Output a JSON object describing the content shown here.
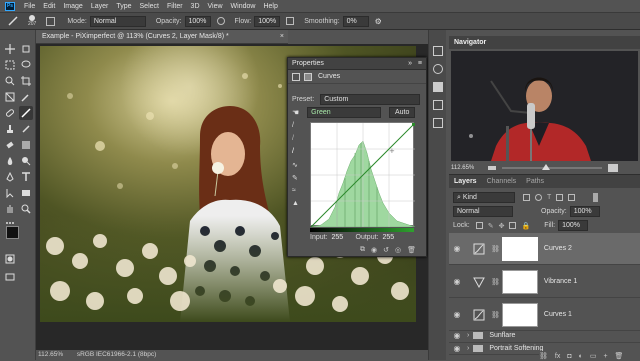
{
  "app": {
    "logo": "Ps"
  },
  "menu": [
    "File",
    "Edit",
    "Image",
    "Layer",
    "Type",
    "Select",
    "Filter",
    "3D",
    "View",
    "Window",
    "Help"
  ],
  "options": {
    "brush_size": "207",
    "mode_label": "Mode:",
    "mode_value": "Normal",
    "opacity_label": "Opacity:",
    "opacity_value": "100%",
    "flow_label": "Flow:",
    "flow_value": "100%",
    "smoothing_label": "Smoothing:",
    "smoothing_value": "0%"
  },
  "document": {
    "tab_title": "Example - PiXimperfect @ 113% (Curves 2, Layer Mask/8) *",
    "zoom": "112.65%",
    "color_profile": "sRGB IEC61966-2.1 (8bpc)"
  },
  "properties": {
    "title": "Properties",
    "subtitle": "Curves",
    "preset_label": "Preset:",
    "preset_value": "Custom",
    "channel_value": "Green",
    "auto_label": "Auto",
    "input_label": "Input:",
    "input_value": "255",
    "output_label": "Output:",
    "output_value": "255"
  },
  "navigator": {
    "title": "Navigator",
    "zoom": "112.65%"
  },
  "layers": {
    "tabs": [
      "Layers",
      "Channels",
      "Paths"
    ],
    "filter_kind": "Kind",
    "blend_mode": "Normal",
    "opacity_label": "Opacity:",
    "opacity_value": "100%",
    "lock_label": "Lock:",
    "fill_label": "Fill:",
    "fill_value": "100%",
    "items": [
      {
        "name": "Curves 2",
        "kind": "curves-icon"
      },
      {
        "name": "Vibrance 1",
        "kind": "vibrance-icon"
      },
      {
        "name": "Curves 1",
        "kind": "curves-icon"
      },
      {
        "name": "Sunflare",
        "kind": "folder-icon"
      },
      {
        "name": "Portrait Softening",
        "kind": "folder-icon"
      }
    ]
  },
  "colors": {
    "accent": "#31a8ff",
    "curve_fill": "#9fd8a0",
    "panel": "#535353",
    "header": "#424242"
  }
}
